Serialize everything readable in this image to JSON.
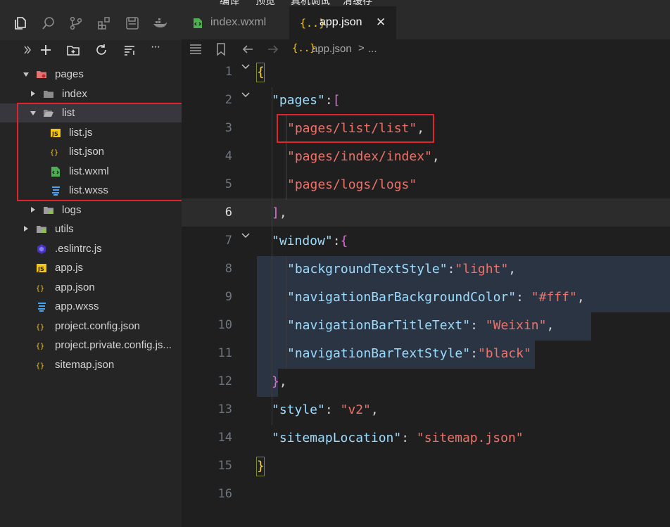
{
  "top_strip": {
    "labels": [
      "编译",
      "预览",
      "真机调试",
      "清缓存"
    ]
  },
  "activity_bar": {
    "icons": [
      "files-icon",
      "search-icon",
      "source-control-icon",
      "extensions-icon",
      "save-icon",
      "docker-icon"
    ]
  },
  "explorer_toolbar": {
    "icons": [
      "collapse-icon",
      "new-file-icon",
      "new-folder-icon",
      "refresh-icon",
      "sort-icon",
      "more-icon"
    ],
    "more_label": "···"
  },
  "file_tree": [
    {
      "label": "pages",
      "type": "folder",
      "open": true,
      "depth": 0
    },
    {
      "label": "index",
      "type": "folder",
      "open": false,
      "depth": 1
    },
    {
      "label": "list",
      "type": "folder",
      "open": true,
      "depth": 1,
      "selected": true
    },
    {
      "label": "list.js",
      "type": "js",
      "depth": 2
    },
    {
      "label": "list.json",
      "type": "json",
      "depth": 2
    },
    {
      "label": "list.wxml",
      "type": "wxml",
      "depth": 2
    },
    {
      "label": "list.wxss",
      "type": "wxss",
      "depth": 2
    },
    {
      "label": "logs",
      "type": "folder",
      "open": false,
      "depth": 1
    },
    {
      "label": "utils",
      "type": "folder",
      "open": false,
      "depth": 0
    },
    {
      "label": ".eslintrc.js",
      "type": "eslint",
      "depth": 0
    },
    {
      "label": "app.js",
      "type": "js",
      "depth": 0
    },
    {
      "label": "app.json",
      "type": "json",
      "depth": 0
    },
    {
      "label": "app.wxss",
      "type": "wxss",
      "depth": 0
    },
    {
      "label": "project.config.json",
      "type": "json",
      "depth": 0
    },
    {
      "label": "project.private.config.js...",
      "type": "json",
      "depth": 0
    },
    {
      "label": "sitemap.json",
      "type": "json",
      "depth": 0
    }
  ],
  "tabs": [
    {
      "label": "index.wxml",
      "active": false
    },
    {
      "label": "app.json",
      "active": true,
      "close_glyph": "✕"
    }
  ],
  "breadcrumbs": {
    "file_glyph": "{..}",
    "file": "app.json",
    "sep": ">",
    "tail": "..."
  },
  "editor": {
    "current_line": 6,
    "lines": [
      {
        "n": "1"
      },
      {
        "n": "2"
      },
      {
        "n": "3"
      },
      {
        "n": "4"
      },
      {
        "n": "5"
      },
      {
        "n": "6"
      },
      {
        "n": "7"
      },
      {
        "n": "8"
      },
      {
        "n": "9"
      },
      {
        "n": "10"
      },
      {
        "n": "11"
      },
      {
        "n": "12"
      },
      {
        "n": "13"
      },
      {
        "n": "14"
      },
      {
        "n": "15"
      },
      {
        "n": "16"
      }
    ],
    "tokens": {
      "open_brace": "{",
      "pages_key": "\"pages\"",
      "colon": ":",
      "open_bracket": "[",
      "page1": "\"pages/list/list\"",
      "comma": ",",
      "page2": "\"pages/index/index\"",
      "page3": "\"pages/logs/logs\"",
      "close_bracket": "]",
      "window_key": "\"window\"",
      "bg_text_key": "\"backgroundTextStyle\"",
      "bg_text_val": "\"light\"",
      "nav_bg_key": "\"navigationBarBackgroundColor\"",
      "nav_bg_val": "\"#fff\"",
      "nav_title_key": "\"navigationBarTitleText\"",
      "nav_title_val": "\"Weixin\"",
      "nav_text_key": "\"navigationBarTextStyle\"",
      "nav_text_val": "\"black\"",
      "close_brace_inner": "}",
      "style_key": "\"style\"",
      "style_val": "\"v2\"",
      "sitemap_key": "\"sitemapLocation\"",
      "sitemap_val": "\"sitemap.json\"",
      "close_brace": "}",
      "colon_sp": ": "
    }
  },
  "colors": {
    "highlight_box": "#e0242c",
    "string": "#f07167",
    "key": "#9cdcfe",
    "brace": "#f5d547"
  }
}
